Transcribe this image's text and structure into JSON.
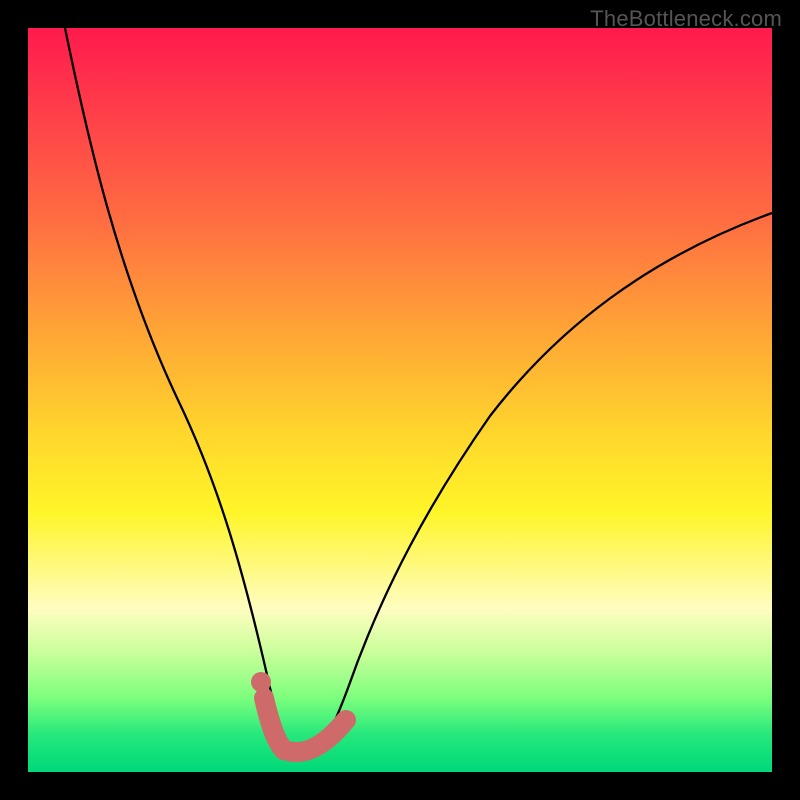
{
  "watermark": {
    "text": "TheBottleneck.com"
  },
  "colors": {
    "background_black": "#000000",
    "curve_stroke": "#000000",
    "highlight": "#cf6a6a",
    "gradient_stops": [
      "#ff1a4d",
      "#ff3a4a",
      "#ff6a42",
      "#ffa236",
      "#ffd82c",
      "#fff528",
      "#fff97a",
      "#fffdc0",
      "#c9ff9a",
      "#7dff7d",
      "#25e87c",
      "#00d879"
    ]
  },
  "chart_data": {
    "type": "line",
    "title": "",
    "xlabel": "",
    "ylabel": "",
    "xlim": [
      0,
      100
    ],
    "ylim": [
      0,
      100
    ],
    "legend": false,
    "grid": false,
    "series": [
      {
        "name": "bottleneck-curve",
        "x": [
          5,
          8,
          12,
          16,
          20,
          24,
          27,
          30,
          33,
          34,
          37,
          40,
          44,
          48,
          54,
          62,
          72,
          84,
          100
        ],
        "y": [
          100,
          85,
          67,
          52,
          40,
          29,
          20,
          12,
          5,
          3,
          2.5,
          3,
          6,
          13,
          24,
          36,
          48,
          58,
          68
        ]
      }
    ],
    "highlight": {
      "dot": {
        "x": 31.5,
        "y": 9
      },
      "segments": [
        {
          "x": [
            32,
            33,
            34
          ],
          "y": [
            7,
            5,
            3
          ]
        },
        {
          "x": [
            34,
            37,
            40,
            43
          ],
          "y": [
            3,
            2.5,
            3,
            5
          ]
        }
      ]
    },
    "note": "Axes are implicit (no ticks/labels shown); values are estimated in percentage units 0–100 mapped to the gradient area."
  }
}
